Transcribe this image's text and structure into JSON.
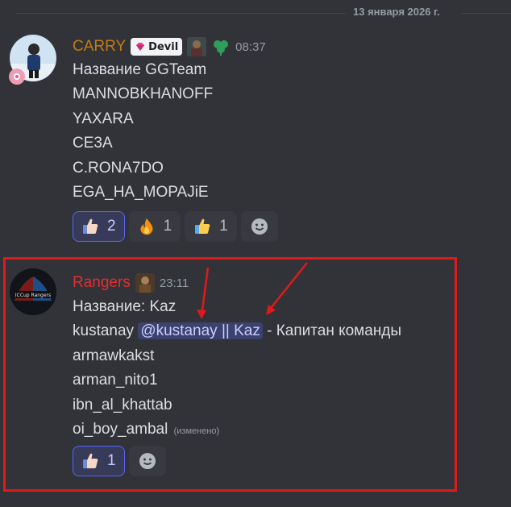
{
  "divider": {
    "date": "13 января 2026 г."
  },
  "messages": [
    {
      "username": "CARRY",
      "username_color": "#c27c0e",
      "tag_label": "Devil",
      "time": "08:37",
      "lines": [
        "Название GGTeam",
        "MANNOBKHANOFF",
        "YAXARA",
        "CE3A",
        "C.RONA7DO",
        "EGA_HA_MOPAJiE"
      ],
      "reactions": [
        {
          "emoji": "thumbs-up-light-skin",
          "count": "2",
          "selected": true
        },
        {
          "emoji": "fire",
          "count": "1",
          "selected": false
        },
        {
          "emoji": "thumbs-up",
          "count": "1",
          "selected": false
        }
      ]
    },
    {
      "username": "Rangers",
      "username_color": "#e02f2f",
      "time": "23:11",
      "line1": "Название: Kaz",
      "line2_prefix": "kustanay ",
      "mention": "@kustanay || Kaz",
      "line2_suffix": " - Капитан команды",
      "lines_rest": [
        "armawkakst",
        "arman_nito1",
        "ibn_al_khattab"
      ],
      "last_line": "oi_boy_ambal",
      "edited": "(изменено)",
      "reactions": [
        {
          "emoji": "thumbs-up-light-skin",
          "count": "1",
          "selected": true
        }
      ]
    }
  ],
  "colors": {
    "highlight": "#e01a1a",
    "background": "#323339",
    "mention_bg": "#3c4270"
  }
}
